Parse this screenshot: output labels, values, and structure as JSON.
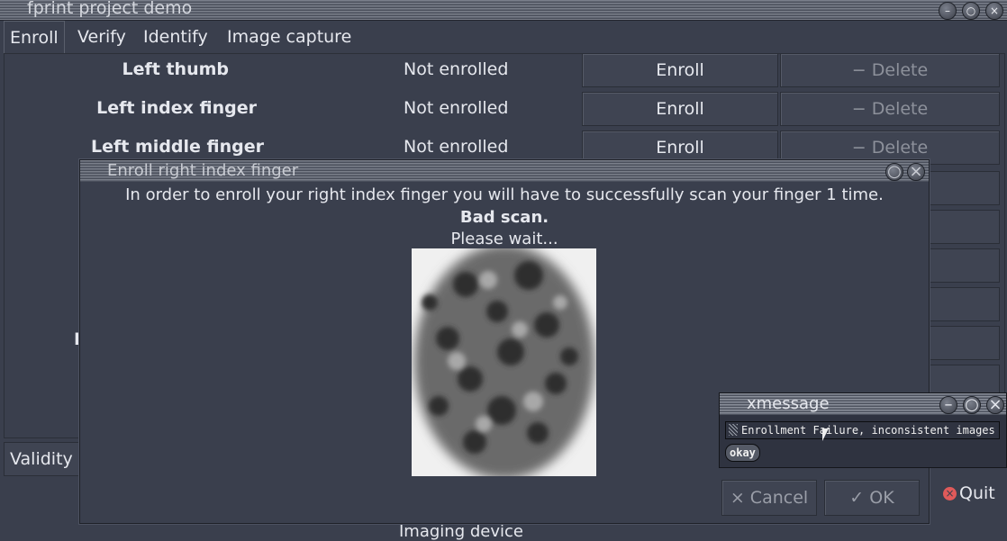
{
  "main_window": {
    "title": "fprint project demo",
    "tabs": [
      "Enroll",
      "Verify",
      "Identify",
      "Image capture"
    ],
    "active_tab": "Enroll",
    "rows": [
      {
        "finger": "Left thumb",
        "status": "Not enrolled",
        "enroll_label": "Enroll",
        "delete_label": "Delete"
      },
      {
        "finger": "Left index finger",
        "status": "Not enrolled",
        "enroll_label": "Enroll",
        "delete_label": "Delete"
      },
      {
        "finger": "Left middle finger",
        "status": "Not enrolled",
        "enroll_label": "Enroll",
        "delete_label": "Delete"
      }
    ],
    "partial_letter": "I",
    "validity_label": "Validity",
    "quit_label": "Quit",
    "imaging_device_label": "Imaging device"
  },
  "enroll_dialog": {
    "title": "Enroll right index finger",
    "instruction": "In order to enroll your right index finger you will have to successfully scan your finger 1 time.",
    "status": "Bad scan.",
    "wait_text": "Please wait...",
    "cancel_label": "Cancel",
    "ok_label": "OK"
  },
  "xmessage": {
    "title": "xmessage",
    "message": "Enrollment Failure, inconsistent images",
    "okay_label": "okay"
  },
  "icons": {
    "delete": "minus-icon",
    "cancel": "x-icon",
    "ok": "check-icon",
    "quit": "close-circle-icon"
  },
  "colors": {
    "background": "#3a3f4d",
    "text": "#e6e8ee",
    "quit_icon": "#e05a5a"
  }
}
